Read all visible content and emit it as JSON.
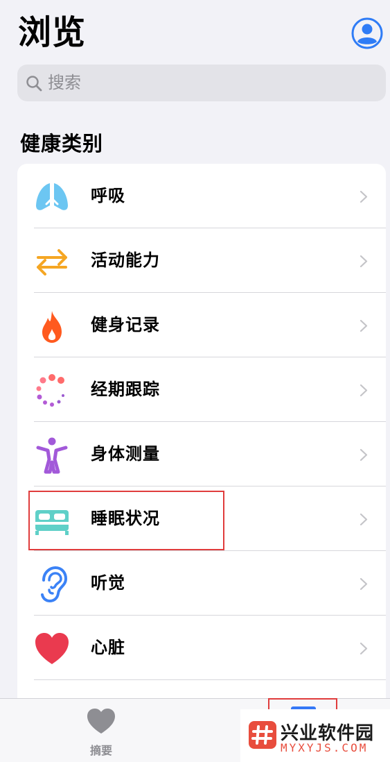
{
  "header": {
    "title": "浏览"
  },
  "search": {
    "placeholder": "搜索"
  },
  "section": {
    "title": "健康类别"
  },
  "categories": [
    {
      "label": "呼吸",
      "icon": "lungs-icon",
      "color": "#5ac8fa"
    },
    {
      "label": "活动能力",
      "icon": "arrows-left-right-icon",
      "color": "#f5a623"
    },
    {
      "label": "健身记录",
      "icon": "flame-icon",
      "color": "#ff5a1f"
    },
    {
      "label": "经期跟踪",
      "icon": "cycle-dots-icon",
      "color": "#ff5a6e"
    },
    {
      "label": "身体测量",
      "icon": "person-figure-icon",
      "color": "#a259d9"
    },
    {
      "label": "睡眠状况",
      "icon": "bed-icon",
      "color": "#5fd0c8"
    },
    {
      "label": "听觉",
      "icon": "ear-icon",
      "color": "#3b82f6"
    },
    {
      "label": "心脏",
      "icon": "heart-icon",
      "color": "#ea3a4f"
    }
  ],
  "tabbar": {
    "summary_label": "摘要"
  },
  "watermark": {
    "title": "兴业软件园",
    "subtitle": "MYXYJS.COM"
  }
}
